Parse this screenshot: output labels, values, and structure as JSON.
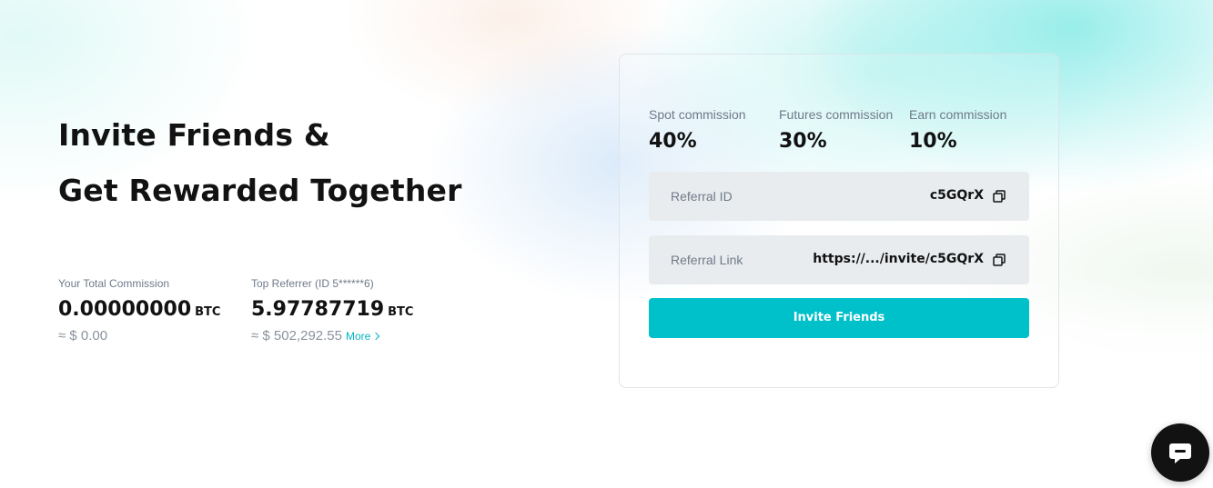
{
  "hero": {
    "title_line1": "Invite Friends &",
    "title_line2": "Get Rewarded Together"
  },
  "stats": {
    "total_commission": {
      "label": "Your Total Commission",
      "value": "0.00000000",
      "unit": "BTC",
      "approx": "≈ $ 0.00"
    },
    "top_referrer": {
      "label": "Top Referrer (ID 5******6)",
      "value": "5.97787719",
      "unit": "BTC",
      "approx": "≈ $ 502,292.55",
      "more_label": "More"
    }
  },
  "card": {
    "commissions": [
      {
        "label": "Spot commission",
        "value": "40%"
      },
      {
        "label": "Futures commission",
        "value": "30%"
      },
      {
        "label": "Earn commission",
        "value": "10%"
      }
    ],
    "referral_id": {
      "label": "Referral ID",
      "value": "c5GQrX"
    },
    "referral_link": {
      "label": "Referral Link",
      "value": "https://.../invite/c5GQrX"
    },
    "invite_button_label": "Invite Friends"
  },
  "icons": {
    "copy": "copy-icon",
    "chat": "chat-icon",
    "chevron": "chevron-right-icon"
  },
  "colors": {
    "accent": "#00c0ca",
    "text_primary": "#121212",
    "text_secondary": "#707a8a",
    "field_bg": "#e8ecef"
  }
}
